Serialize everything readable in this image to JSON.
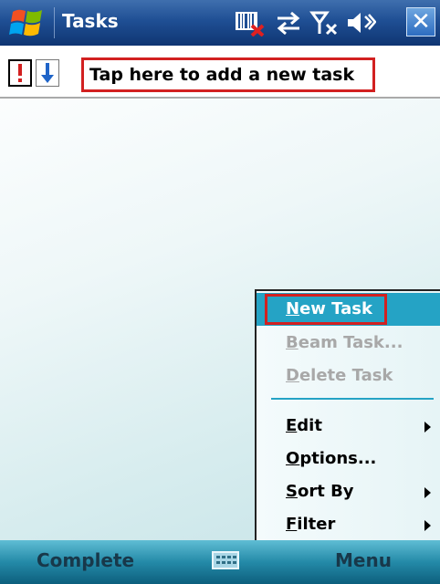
{
  "titlebar": {
    "title": "Tasks",
    "icons": [
      "windows-start-icon",
      "barcode-icon",
      "connectivity-icon",
      "signal-off-icon",
      "volume-icon",
      "close-icon"
    ],
    "close_label": "✕"
  },
  "entry_bar": {
    "priority_high_icon": "exclamation-icon",
    "priority_low_icon": "arrow-down-icon",
    "placeholder": "Tap here to add a new task"
  },
  "menu": {
    "items": [
      {
        "label": "New Task",
        "accel": "N",
        "state": "selected"
      },
      {
        "label": "Beam Task...",
        "accel": "B",
        "state": "disabled"
      },
      {
        "label": "Delete Task",
        "accel": "D",
        "state": "disabled"
      },
      {
        "label": "Edit",
        "accel": "E",
        "submenu": true
      },
      {
        "label": "Options...",
        "accel": "O"
      },
      {
        "label": "Sort By",
        "accel": "S",
        "submenu": true
      },
      {
        "label": "Filter",
        "accel": "F",
        "submenu": true
      }
    ]
  },
  "softkeys": {
    "left": "Complete",
    "right": "Menu",
    "center_icon": "keyboard-icon"
  },
  "colors": {
    "titlebar": "#1f4f94",
    "menu_highlight": "#25a3c5",
    "annotation_outline": "#d22020",
    "softbar": "#248aa8"
  }
}
